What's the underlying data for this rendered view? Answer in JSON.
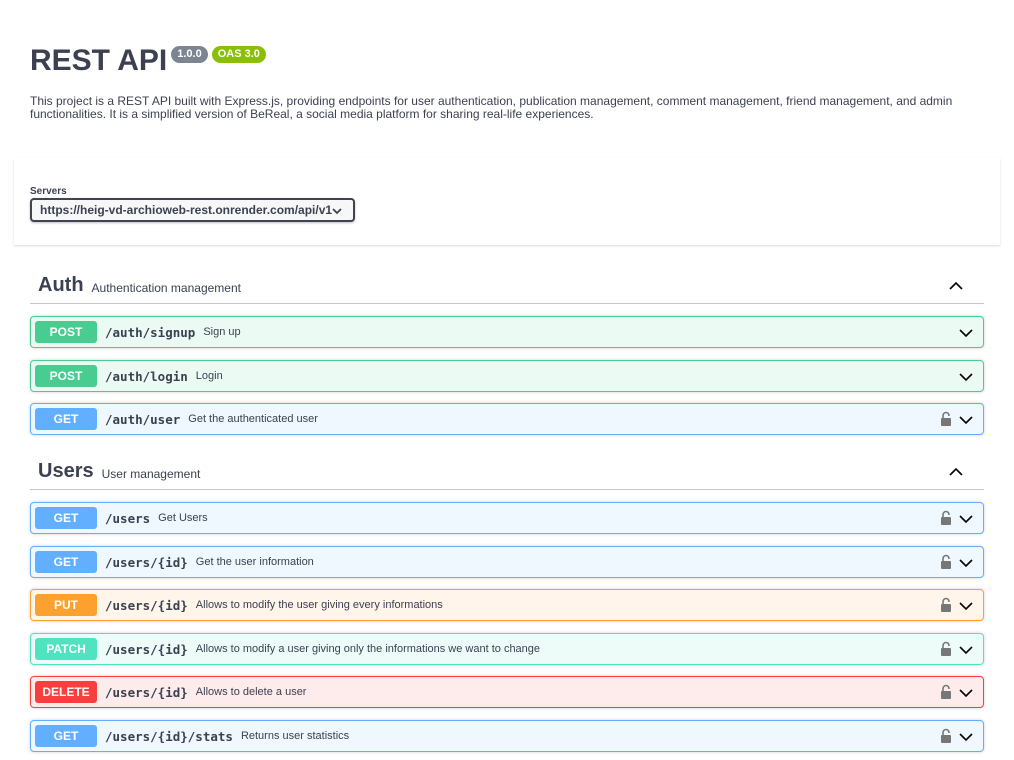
{
  "info": {
    "title": "REST API",
    "version": "1.0.0",
    "oas": "OAS 3.0",
    "description": "This project is a REST API built with Express.js, providing endpoints for user authentication, publication management, comment management, friend management, and admin functionalities. It is a simplified version of BeReal, a social media platform for sharing real-life experiences."
  },
  "servers": {
    "label": "Servers",
    "selected": "https://heig-vd-archioweb-rest.onrender.com/api/v1"
  },
  "tags": [
    {
      "name": "Auth",
      "description": "Authentication management",
      "operations": [
        {
          "method": "POST",
          "path": "/auth/signup",
          "summary": "Sign up"
        },
        {
          "method": "POST",
          "path": "/auth/login",
          "summary": "Login"
        },
        {
          "method": "GET",
          "path": "/auth/user",
          "summary": "Get the authenticated user"
        }
      ]
    },
    {
      "name": "Users",
      "description": "User management",
      "operations": [
        {
          "method": "GET",
          "path": "/users",
          "summary": "Get Users"
        },
        {
          "method": "GET",
          "path": "/users/{id}",
          "summary": "Get the user information"
        },
        {
          "method": "PUT",
          "path": "/users/{id}",
          "summary": "Allows to modify the user giving every informations"
        },
        {
          "method": "PATCH",
          "path": "/users/{id}",
          "summary": "Allows to modify a user giving only the informations we want to change"
        },
        {
          "method": "DELETE",
          "path": "/users/{id}",
          "summary": "Allows to delete a user"
        },
        {
          "method": "GET",
          "path": "/users/{id}/stats",
          "summary": "Returns user statistics"
        }
      ]
    }
  ],
  "icons": {
    "lock": "lock-icon",
    "chevron_down": "chevron-down-icon",
    "chevron_up": "chevron-up-icon"
  },
  "colors": {
    "post": "#49cc90",
    "get": "#61affe",
    "put": "#fca130",
    "patch": "#50e3c2",
    "delete": "#f93e3e",
    "version_badge": "#7d8492",
    "oas_badge": "#89bf04"
  }
}
